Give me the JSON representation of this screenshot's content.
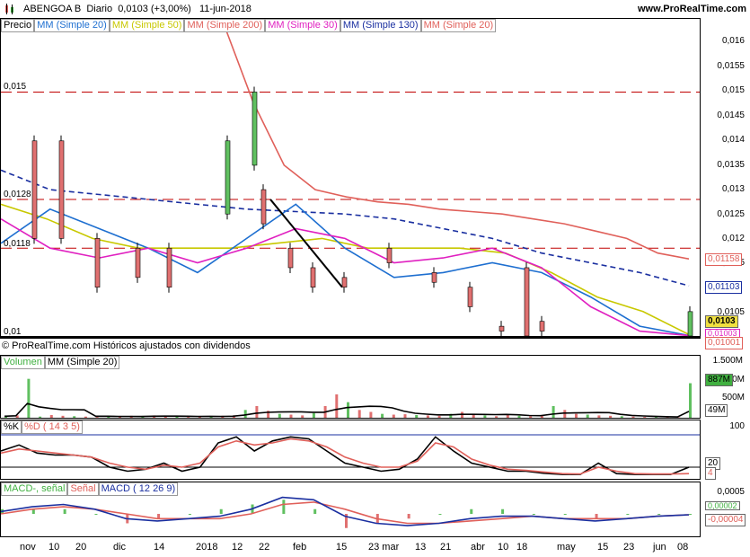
{
  "header": {
    "symbol": "ABENGOA B",
    "period": "Diario",
    "price_change": "0,0103 (+3,00%)",
    "date": "11-jun-2018",
    "site": "www.ProRealTime.com"
  },
  "price_legend": [
    {
      "label": "Precio",
      "color": "#000000"
    },
    {
      "label": "MM (Simple 20)",
      "color": "#1e6fd0"
    },
    {
      "label": "MM (Simple 50)",
      "color": "#c8c800"
    },
    {
      "label": "MM (Simple 200)",
      "color": "#e0605a"
    },
    {
      "label": "MM (Simple 30)",
      "color": "#e020c0"
    },
    {
      "label": "MM (Simple 130)",
      "color": "#1a2fa0"
    },
    {
      "label": "MM (Simple 20)",
      "color": "#e0605a"
    }
  ],
  "copyright": "© ProRealTime.com Históricos ajustados con dividendos",
  "volume_legend": {
    "label1": "Volumen",
    "label2": "MM (Simple 20)"
  },
  "stoch_legend": {
    "label1": "%K",
    "label2": "%D ( 14 3 5)"
  },
  "macd_legend": {
    "label1": "MACD-, señal",
    "label2": "Señal",
    "label3": "MACD ( 12 26 9)"
  },
  "x_labels": [
    "nov",
    "10",
    "20",
    "dic",
    "14",
    "2018",
    "12",
    "22",
    "feb",
    "15",
    "23 mar",
    "13",
    "21",
    "abr",
    "10",
    "18",
    "may",
    "15",
    "23",
    "jun",
    "08"
  ],
  "price_axis": [
    "0,016",
    "0,0155",
    "0,015",
    "0,0145",
    "0,014",
    "0,0135",
    "0,013",
    "0,0125",
    "0,012",
    "0,0115",
    "0,011",
    "0,0105",
    "0,01"
  ],
  "price_badges": {
    "last": "0,0103",
    "ma200": "0,01158",
    "ma130": "0,01103",
    "ma50": "0,01003",
    "ma20": "0,01001"
  },
  "price_left_labels": {
    "l1": "0,015",
    "l2": "0,0128",
    "l3": "0,0118",
    "l4": "0,01"
  },
  "volume_axis": [
    "1.500M",
    "1.000M",
    "887M",
    "500M",
    "49M"
  ],
  "stoch_axis": [
    "100",
    "20",
    "4"
  ],
  "macd_axis": [
    "0,0005",
    "0,00002",
    "-0,00004"
  ],
  "chart_data": [
    {
      "type": "line",
      "title": "ABENGOA B Diario",
      "ylim": [
        0.01,
        0.0165
      ],
      "horizontal_lines": [
        0.015,
        0.0128,
        0.0118
      ],
      "series": [
        {
          "name": "MM (Simple 200)",
          "values": [
            0.0165,
            0.0148,
            0.0135,
            0.013,
            0.01285,
            0.01275,
            0.0127,
            0.0126,
            0.01255,
            0.0125,
            0.0124,
            0.0123,
            0.01215,
            0.012,
            0.0117,
            0.01158
          ]
        },
        {
          "name": "MM (Simple 130)",
          "values": [
            0.0134,
            0.013,
            0.0129,
            0.0128,
            0.0127,
            0.0126,
            0.01255,
            0.0125,
            0.0124,
            0.0122,
            0.012,
            0.0117,
            0.0115,
            0.0113,
            0.01103
          ]
        },
        {
          "name": "MM (Simple 50)",
          "values": [
            0.0127,
            0.0124,
            0.012,
            0.0118,
            0.0118,
            0.0118,
            0.0119,
            0.012,
            0.0118,
            0.0118,
            0.0118,
            0.0117,
            0.0113,
            0.0108,
            0.0105,
            0.01003
          ]
        },
        {
          "name": "MM (Simple 20)",
          "values": [
            0.0119,
            0.0126,
            0.0122,
            0.0118,
            0.0113,
            0.012,
            0.0127,
            0.0118,
            0.0112,
            0.0113,
            0.0115,
            0.0113,
            0.0108,
            0.0102,
            0.01001
          ]
        },
        {
          "name": "MM (Simple 30)",
          "values": [
            0.0124,
            0.0118,
            0.0116,
            0.0118,
            0.0115,
            0.0118,
            0.0122,
            0.012,
            0.0115,
            0.0116,
            0.0118,
            0.0114,
            0.0106,
            0.0101,
            0.01001
          ]
        }
      ]
    },
    {
      "type": "bar",
      "title": "Volumen",
      "ylim": [
        0,
        1500
      ],
      "values": [
        40,
        60,
        1000,
        30,
        70,
        50,
        40,
        30,
        20,
        30,
        40,
        50,
        30,
        60,
        40,
        30,
        20,
        30,
        40,
        50,
        60,
        200,
        300,
        180,
        100,
        80,
        60,
        120,
        300,
        600,
        400,
        200,
        150,
        100,
        80,
        90,
        70,
        60,
        50,
        100,
        150,
        90,
        60,
        40,
        70,
        50,
        40,
        60,
        300,
        200,
        100,
        80,
        60,
        50,
        40,
        30,
        20,
        20,
        10,
        10,
        887
      ]
    },
    {
      "type": "line",
      "title": "%K %D ( 14 3 5)",
      "ylim": [
        0,
        100
      ],
      "series": [
        {
          "name": "%K",
          "values": [
            60,
            75,
            55,
            50,
            50,
            45,
            20,
            10,
            15,
            30,
            10,
            20,
            80,
            95,
            60,
            85,
            95,
            90,
            60,
            30,
            20,
            10,
            15,
            40,
            95,
            60,
            30,
            20,
            10,
            10,
            5,
            2,
            2,
            30,
            4,
            2,
            2,
            2,
            20
          ]
        },
        {
          "name": "%D",
          "values": [
            55,
            65,
            60,
            55,
            50,
            45,
            30,
            20,
            15,
            25,
            20,
            30,
            70,
            85,
            75,
            80,
            90,
            85,
            70,
            45,
            30,
            20,
            20,
            35,
            80,
            70,
            40,
            25,
            15,
            12,
            8,
            4,
            3,
            20,
            10,
            4,
            3,
            3,
            4
          ]
        }
      ]
    },
    {
      "type": "line",
      "title": "MACD ( 12 26 9)",
      "ylim": [
        -0.0008,
        0.0008
      ],
      "series": [
        {
          "name": "MACD",
          "values": [
            0.0001,
            0.0003,
            0.0004,
            0.0002,
            -0.0002,
            -0.0003,
            -0.0002,
            -0.0001,
            0.0002,
            0.0007,
            0.0006,
            -0.0001,
            -0.0004,
            -0.0005,
            -0.0004,
            -0.0002,
            -0.0001,
            -0.0001,
            -0.0002,
            -0.0003,
            -0.0002,
            -0.0001,
            -4e-05
          ]
        },
        {
          "name": "Señal",
          "values": [
            0.0,
            0.0002,
            0.0003,
            0.0002,
            0.0,
            -0.0002,
            -0.0002,
            -0.0002,
            0.0,
            0.0004,
            0.0005,
            0.0002,
            -0.0002,
            -0.0004,
            -0.0004,
            -0.0003,
            -0.0002,
            -0.0001,
            -0.0002,
            -0.0002,
            -0.0002,
            -0.0001,
            -4e-05
          ]
        }
      ]
    }
  ]
}
